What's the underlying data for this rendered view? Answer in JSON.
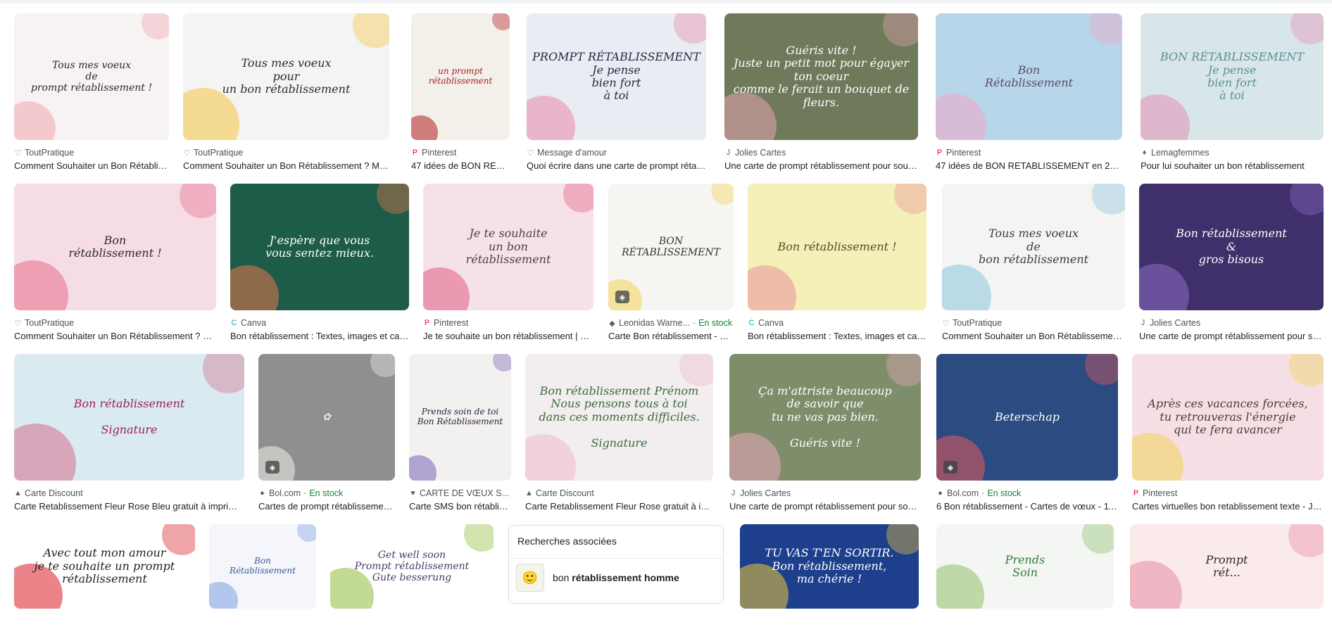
{
  "cards": [
    {
      "source": "ToutPratique",
      "favicon": "♡",
      "stock": "",
      "title": "Comment Souhaiter un Bon Rétablissement ? Mots et ...",
      "thumb_text": "Tous mes voeux\nde\nprompt rétablissement !",
      "thumb_bg": "#f6f3f2",
      "thumb_fg": "#2b2b2b",
      "accent": "#f2a5b1"
    },
    {
      "source": "ToutPratique",
      "favicon": "♡",
      "stock": "",
      "title": "Comment Souhaiter un Bon Rétablissement ? Mots et ...",
      "thumb_text": "Tous mes voeux\npour\nun bon rétablissement",
      "thumb_bg": "#f4f4f2",
      "thumb_fg": "#2b2b2b",
      "accent": "#f5c542"
    },
    {
      "source": "Pinterest",
      "favicon": "P",
      "stock": "",
      "title": "47 idées de BON RETABLISSEMENT ...",
      "thumb_text": "un prompt\nrétablissement",
      "thumb_bg": "#f3efe9",
      "thumb_fg": "#a32424",
      "accent": "#b11d22"
    },
    {
      "source": "Message d'amour",
      "favicon": "♡",
      "stock": "",
      "title": "Quoi écrire dans une carte de prompt rétablissement ?",
      "thumb_text": "PROMPT RÉTABLISSEMENT\nJe pense\nbien fort\nà toi",
      "thumb_bg": "#e9ecf2",
      "thumb_fg": "#1e2a44",
      "accent": "#e789a9"
    },
    {
      "source": "Jolies Cartes",
      "favicon": "J",
      "stock": "",
      "title": "Une carte de prompt rétablissement pour soutenir ...",
      "thumb_text": "Guéris vite !\nJuste un petit mot pour égayer ton coeur\ncomme le ferait un bouquet de fleurs.",
      "thumb_bg": "#6e7a5a",
      "thumb_fg": "#ffffff",
      "accent": "#e6a3b2"
    },
    {
      "source": "Pinterest",
      "favicon": "P",
      "stock": "",
      "title": "47 idées de BON RETABLISSEMENT en 2022 | bon ...",
      "thumb_text": "Bon\nRétablissement",
      "thumb_bg": "#b8d6ea",
      "thumb_fg": "#5b4a67",
      "accent": "#f3a8c7"
    },
    {
      "source": "Lemagfemmes",
      "favicon": "♦",
      "stock": "",
      "title": "Pour lui souhaiter un bon rétablissement",
      "thumb_text": "BON RÉTABLISSEMENT\nJe pense\nbien fort\nà toi",
      "thumb_bg": "#d8e6ea",
      "thumb_fg": "#5a8f95",
      "accent": "#e58fb4"
    },
    {
      "source": "ToutPratique",
      "favicon": "♡",
      "stock": "",
      "title": "Comment Souhaiter un Bon Rétablissement ? Mots et ...",
      "thumb_text": "Bon\nrétablissement !",
      "thumb_bg": "#f6dce4",
      "thumb_fg": "#2b2b2b",
      "accent": "#e86d8b"
    },
    {
      "source": "Canva",
      "favicon": "C",
      "stock": "",
      "title": "Bon rétablissement : Textes, images et cartes",
      "thumb_text": "J'espère que vous\nvous sentez mieux.",
      "thumb_bg": "#1e5c4a",
      "thumb_fg": "#ffffff",
      "accent": "#e9784a"
    },
    {
      "source": "Pinterest",
      "favicon": "P",
      "stock": "",
      "title": "Je te souhaite un bon rétablissement | Bon ...",
      "thumb_text": "Je te souhaite\nun bon\nrétablissement",
      "thumb_bg": "#f6e1e8",
      "thumb_fg": "#444444",
      "accent": "#e05f82"
    },
    {
      "source": "Leonidas Warne...",
      "favicon": "◆",
      "stock": "En stock",
      "title": "Carte Bon rétablissement - B-...",
      "thumb_text": "BON\nRÉTABLISSEMENT",
      "thumb_bg": "#f7f5f2",
      "thumb_fg": "#333333",
      "accent": "#f2d45a"
    },
    {
      "source": "Canva",
      "favicon": "C",
      "stock": "",
      "title": "Bon rétablissement : Textes, images et cartes",
      "thumb_text": "Bon rétablissement !",
      "thumb_bg": "#f4f0b8",
      "thumb_fg": "#5a4a2a",
      "accent": "#e8939b"
    },
    {
      "source": "ToutPratique",
      "favicon": "♡",
      "stock": "",
      "title": "Comment Souhaiter un Bon Rétablissement ? Mots et ...",
      "thumb_text": "Tous mes voeux\nde\nbon rétablissement",
      "thumb_bg": "#f4f4f2",
      "thumb_fg": "#3c3c3c",
      "accent": "#8cc4e0"
    },
    {
      "source": "Jolies Cartes",
      "favicon": "J",
      "stock": "",
      "title": "Une carte de prompt rétablissement pour soutenir ...",
      "thumb_text": "Bon rétablissement\n&\ngros bisous",
      "thumb_bg": "#3f2f6a",
      "thumb_fg": "#ffffff",
      "accent": "#8d6dc9"
    },
    {
      "source": "Carte Discount",
      "favicon": "▲",
      "stock": "",
      "title": "Carte Retablissement Fleur Rose Bleu gratuit à imprimer ...",
      "thumb_text": "Bon rétablissement\n\nSignature",
      "thumb_bg": "#d9eaf0",
      "thumb_fg": "#a01e5a",
      "accent": "#d3708e"
    },
    {
      "source": "Bol.com",
      "favicon": "●",
      "stock": "En stock",
      "title": "Cartes de prompt rétablissement ...",
      "thumb_text": "✿",
      "thumb_bg": "#8f8f8f",
      "thumb_fg": "#efeae0",
      "accent": "#f4f1ea"
    },
    {
      "source": "CARTE DE VŒUX S...",
      "favicon": "♥",
      "stock": "",
      "title": "Carte SMS bon rétablissement ...",
      "thumb_text": "Prends soin de toi\nBon Rétablissement",
      "thumb_bg": "#f3f1ef",
      "thumb_fg": "#2a2240",
      "accent": "#7a63b8"
    },
    {
      "source": "Carte Discount",
      "favicon": "▲",
      "stock": "",
      "title": "Carte Retablissement Fleur Rose gratuit à imprimer ...",
      "thumb_text": "Bon rétablissement Prénom\nNous pensons tous à toi\ndans ces moments difficiles.\n\nSignature",
      "thumb_bg": "#f2eef0",
      "thumb_fg": "#3a6a3a",
      "accent": "#efb9cd"
    },
    {
      "source": "Jolies Cartes",
      "favicon": "J",
      "stock": "",
      "title": "Une carte de prompt rétablissement pour soutenir ...",
      "thumb_text": "Ça m'attriste beaucoup\nde savoir que\ntu ne vas pas bien.\n\nGuéris vite !",
      "thumb_bg": "#7e8e6b",
      "thumb_fg": "#ffffff",
      "accent": "#e9a8bb"
    },
    {
      "source": "Bol.com",
      "favicon": "●",
      "stock": "En stock",
      "title": "6 Bon rétablissement - Cartes de vœux - 11 ...",
      "thumb_text": "Beterschap",
      "thumb_bg": "#2c4b80",
      "thumb_fg": "#ffffff",
      "accent": "#e75a5a"
    },
    {
      "source": "Pinterest",
      "favicon": "P",
      "stock": "",
      "title": "Cartes virtuelles bon retablissement texte - Jo...",
      "thumb_text": "Après ces vacances forcées,\ntu retrouveras l'énergie\nqui te fera avancer",
      "thumb_bg": "#f6dfe4",
      "thumb_fg": "#4a3a3a",
      "accent": "#f1d25a"
    },
    {
      "source": "",
      "favicon": "",
      "stock": "",
      "title": "",
      "thumb_text": "Avec tout mon amour\nje te souhaite un prompt rétablissement",
      "thumb_bg": "#ffffff",
      "thumb_fg": "#222222",
      "accent": "#d81f26"
    },
    {
      "source": "",
      "favicon": "",
      "stock": "",
      "title": "",
      "thumb_text": "Bon\nRétablissement",
      "thumb_bg": "#f4f6fb",
      "thumb_fg": "#345a9a",
      "accent": "#7aa1e0"
    },
    {
      "source": "",
      "favicon": "",
      "stock": "",
      "title": "",
      "thumb_text": "Get well soon\nPrompt rétablissement\nGute besserung",
      "thumb_bg": "#ffffff",
      "thumb_fg": "#4a3a6a",
      "accent": "#8fbc3a"
    },
    {
      "source": "",
      "favicon": "",
      "stock": "",
      "title": "",
      "thumb_text": "TU VAS T'EN SORTIR.\nBon rétablissement,\nma chérie !",
      "thumb_bg": "#1d3f8c",
      "thumb_fg": "#ffffff",
      "accent": "#f2c93a"
    },
    {
      "source": "",
      "favicon": "",
      "stock": "",
      "title": "",
      "thumb_text": "Prends\nSoin",
      "thumb_bg": "#f4f6f4",
      "thumb_fg": "#2f7d3a",
      "accent": "#8fc16a"
    },
    {
      "source": "",
      "favicon": "",
      "stock": "",
      "title": "",
      "thumb_text": "Prompt\nrét...",
      "thumb_bg": "#fbeaea",
      "thumb_fg": "#2a2a2a",
      "accent": "#e98aa4"
    }
  ],
  "related": {
    "heading": "Recherches associées",
    "item_prefix": "bon ",
    "item_bold": "rétablissement homme"
  }
}
